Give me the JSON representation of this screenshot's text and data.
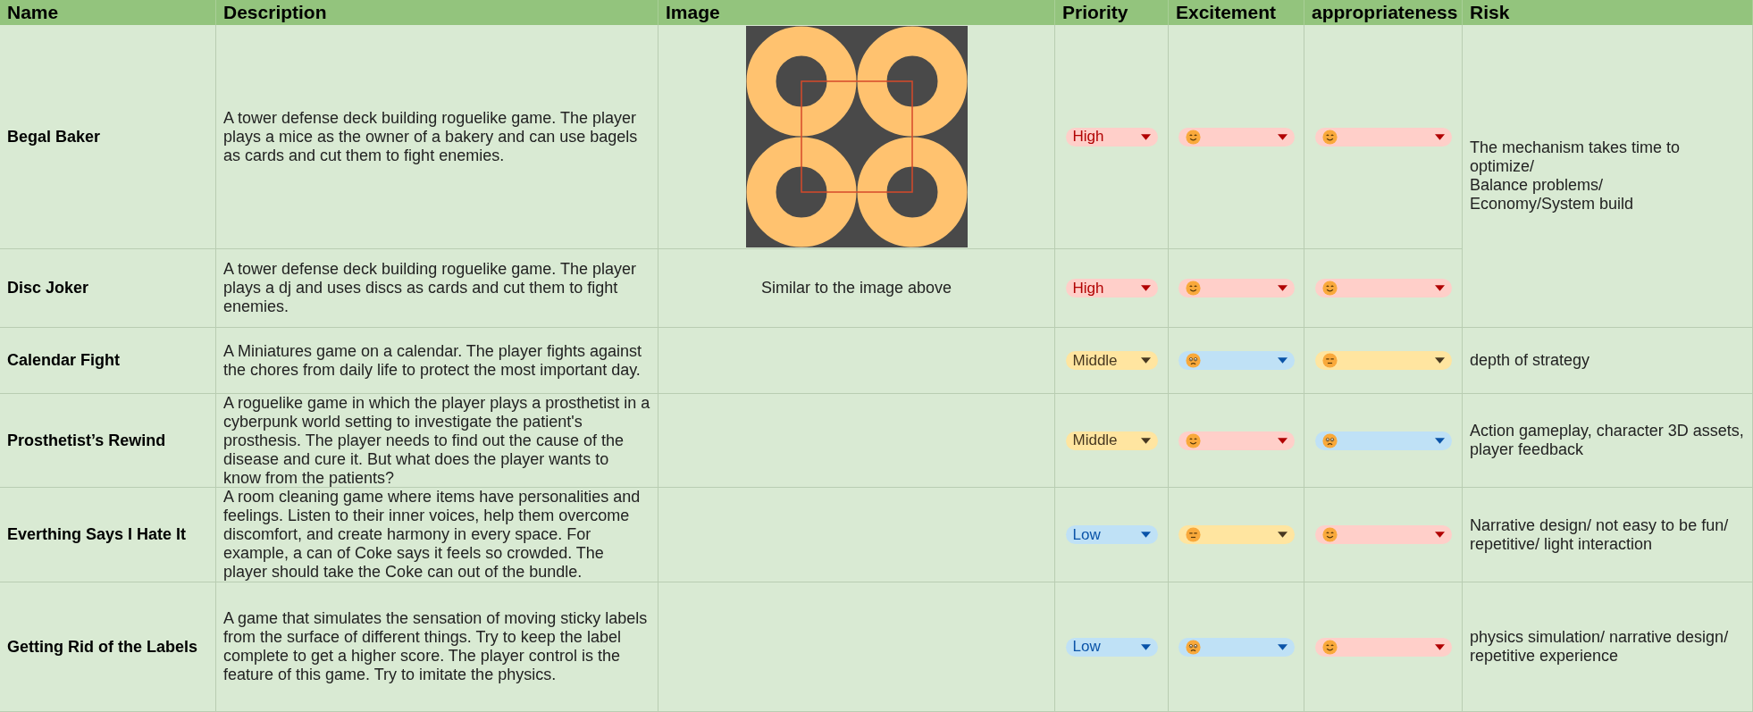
{
  "table": {
    "columns": [
      "Name",
      "Description",
      "Image",
      "Priority",
      "Excitement",
      "appropriateness",
      "Risk"
    ],
    "rows": [
      {
        "name": "Begal Baker",
        "description": "A tower defense deck building roguelike game. The player plays a mice as the owner of a bakery and can use bagels as cards and cut them to fight enemies.",
        "image": {
          "kind": "picture"
        },
        "priority": {
          "label": "High",
          "kind": "high"
        },
        "excitement": {
          "kind": "smiling"
        },
        "appropriateness": {
          "kind": "smiling"
        },
        "risk": "The mechanism takes time to optimize/\nBalance problems/\nEconomy/System build"
      },
      {
        "name": "Disc Joker",
        "description": "A tower defense deck building roguelike game. The player plays a dj and uses discs as cards and cut them to fight enemies.",
        "image": {
          "kind": "note",
          "text": "Similar to the image above"
        },
        "priority": {
          "label": "High",
          "kind": "high"
        },
        "excitement": {
          "kind": "smiling"
        },
        "appropriateness": {
          "kind": "smiling"
        }
      },
      {
        "name": "Calendar Fight",
        "description": "A Miniatures game on a calendar. The player fights against the chores from daily life to protect the most important day.",
        "priority": {
          "label": "Middle",
          "kind": "middle"
        },
        "excitement": {
          "kind": "frowning"
        },
        "appropriateness": {
          "kind": "neutral"
        },
        "risk": "depth of strategy"
      },
      {
        "name": "Prosthetist’s Rewind",
        "description": "A roguelike game in which the player plays a prosthetist in a cyberpunk world setting to investigate the patient's prosthesis. The player needs to find out the cause of the disease and cure it. But what does the player wants to know from the patients?",
        "priority": {
          "label": "Middle",
          "kind": "middle"
        },
        "excitement": {
          "kind": "smiling"
        },
        "appropriateness": {
          "kind": "frowning"
        },
        "risk": "Action gameplay, character 3D assets, player feedback"
      },
      {
        "name": "Everthing Says I Hate It",
        "description": "A room cleaning game where items have personalities and feelings. Listen to their inner voices, help them overcome discomfort, and create harmony in every space. For example, a can of Coke says it feels so crowded. The player should take the Coke can out of the bundle.",
        "priority": {
          "label": "Low",
          "kind": "low"
        },
        "excitement": {
          "kind": "neutral"
        },
        "appropriateness": {
          "kind": "smiling"
        },
        "risk": "Narrative design/ not easy to be fun/ repetitive/ light interaction"
      },
      {
        "name": "Getting Rid of the Labels",
        "description": "A game that simulates the sensation of moving sticky labels from the surface of different things. Try to keep the label complete to get a higher score. The player control is the feature of this game. Try to imitate the physics.",
        "priority": {
          "label": "Low",
          "kind": "low"
        },
        "excitement": {
          "kind": "frowning"
        },
        "appropriateness": {
          "kind": "smiling"
        },
        "risk": "physics simulation/ narrative design/ repetitive experience"
      }
    ]
  }
}
